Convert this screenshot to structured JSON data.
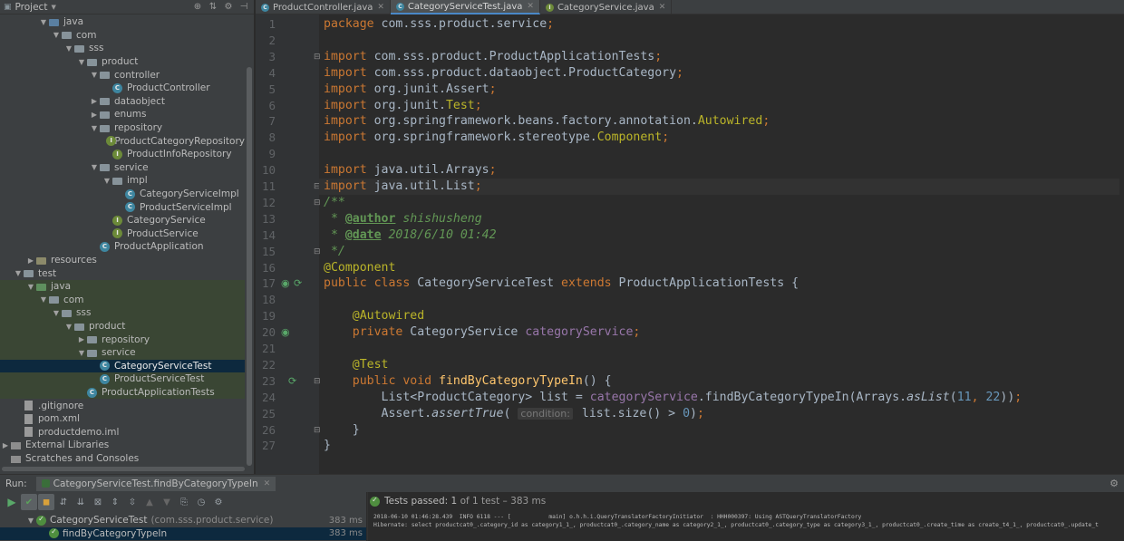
{
  "project": {
    "title": "Project",
    "tree": [
      {
        "label": "java",
        "indent": 3,
        "arrow": "down",
        "icon": "folder-src"
      },
      {
        "label": "com",
        "indent": 4,
        "arrow": "down",
        "icon": "folder"
      },
      {
        "label": "sss",
        "indent": 5,
        "arrow": "down",
        "icon": "folder"
      },
      {
        "label": "product",
        "indent": 6,
        "arrow": "down",
        "icon": "folder"
      },
      {
        "label": "controller",
        "indent": 7,
        "arrow": "down",
        "icon": "folder"
      },
      {
        "label": "ProductController",
        "indent": 8,
        "arrow": "",
        "icon": "cls"
      },
      {
        "label": "dataobject",
        "indent": 7,
        "arrow": "right",
        "icon": "folder"
      },
      {
        "label": "enums",
        "indent": 7,
        "arrow": "right",
        "icon": "folder"
      },
      {
        "label": "repository",
        "indent": 7,
        "arrow": "down",
        "icon": "folder"
      },
      {
        "label": "ProductCategoryRepository",
        "indent": 8,
        "arrow": "",
        "icon": "intf"
      },
      {
        "label": "ProductInfoRepository",
        "indent": 8,
        "arrow": "",
        "icon": "intf"
      },
      {
        "label": "service",
        "indent": 7,
        "arrow": "down",
        "icon": "folder"
      },
      {
        "label": "impl",
        "indent": 8,
        "arrow": "down",
        "icon": "folder"
      },
      {
        "label": "CategoryServiceImpl",
        "indent": 9,
        "arrow": "",
        "icon": "cls"
      },
      {
        "label": "ProductServiceImpl",
        "indent": 9,
        "arrow": "",
        "icon": "cls"
      },
      {
        "label": "CategoryService",
        "indent": 8,
        "arrow": "",
        "icon": "intf"
      },
      {
        "label": "ProductService",
        "indent": 8,
        "arrow": "",
        "icon": "intf"
      },
      {
        "label": "ProductApplication",
        "indent": 7,
        "arrow": "",
        "icon": "cls"
      },
      {
        "label": "resources",
        "indent": 2,
        "arrow": "right",
        "icon": "folder-res"
      },
      {
        "label": "test",
        "indent": 1,
        "arrow": "down",
        "icon": "folder"
      },
      {
        "label": "java",
        "indent": 2,
        "arrow": "down",
        "icon": "folder-test",
        "hl": true
      },
      {
        "label": "com",
        "indent": 3,
        "arrow": "down",
        "icon": "folder",
        "hl": true
      },
      {
        "label": "sss",
        "indent": 4,
        "arrow": "down",
        "icon": "folder",
        "hl": true
      },
      {
        "label": "product",
        "indent": 5,
        "arrow": "down",
        "icon": "folder",
        "hl": true
      },
      {
        "label": "repository",
        "indent": 6,
        "arrow": "right",
        "icon": "folder",
        "hl": true
      },
      {
        "label": "service",
        "indent": 6,
        "arrow": "down",
        "icon": "folder",
        "hl": true
      },
      {
        "label": "CategoryServiceTest",
        "indent": 7,
        "arrow": "",
        "icon": "cls",
        "selected": true
      },
      {
        "label": "ProductServiceTest",
        "indent": 7,
        "arrow": "",
        "icon": "cls",
        "hl": true
      },
      {
        "label": "ProductApplicationTests",
        "indent": 6,
        "arrow": "",
        "icon": "cls",
        "hl": true
      },
      {
        "label": ".gitignore",
        "indent": 1,
        "arrow": "",
        "icon": "file"
      },
      {
        "label": "pom.xml",
        "indent": 1,
        "arrow": "",
        "icon": "file"
      },
      {
        "label": "productdemo.iml",
        "indent": 1,
        "arrow": "",
        "icon": "file"
      },
      {
        "label": "External Libraries",
        "indent": 0,
        "arrow": "right",
        "icon": "lib"
      },
      {
        "label": "Scratches and Consoles",
        "indent": 0,
        "arrow": "",
        "icon": "lib"
      }
    ]
  },
  "tabs": [
    {
      "label": "ProductController.java",
      "icon": "cls",
      "active": false
    },
    {
      "label": "CategoryServiceTest.java",
      "icon": "cls",
      "active": true
    },
    {
      "label": "CategoryService.java",
      "icon": "intf",
      "active": false
    }
  ],
  "editor": {
    "line_numbers": [
      "1",
      "2",
      "3",
      "4",
      "5",
      "6",
      "7",
      "8",
      "9",
      "10",
      "11",
      "12",
      "13",
      "14",
      "15",
      "16",
      "17",
      "18",
      "19",
      "20",
      "21",
      "22",
      "23",
      "24",
      "25",
      "26",
      "27"
    ],
    "current_line": 11,
    "lines": [
      [
        {
          "t": "package ",
          "c": "kw"
        },
        {
          "t": "com.sss.product.service",
          "c": ""
        },
        {
          "t": ";",
          "c": "kw"
        }
      ],
      [],
      [
        {
          "t": "import ",
          "c": "kw"
        },
        {
          "t": "com.sss.product.ProductApplicationTests",
          "c": ""
        },
        {
          "t": ";",
          "c": "kw"
        }
      ],
      [
        {
          "t": "import ",
          "c": "kw"
        },
        {
          "t": "com.sss.product.dataobject.ProductCategory",
          "c": ""
        },
        {
          "t": ";",
          "c": "kw"
        }
      ],
      [
        {
          "t": "import ",
          "c": "kw"
        },
        {
          "t": "org.junit.Assert",
          "c": ""
        },
        {
          "t": ";",
          "c": "kw"
        }
      ],
      [
        {
          "t": "import ",
          "c": "kw"
        },
        {
          "t": "org.junit.",
          "c": ""
        },
        {
          "t": "Test",
          "c": "an"
        },
        {
          "t": ";",
          "c": "kw"
        }
      ],
      [
        {
          "t": "import ",
          "c": "kw"
        },
        {
          "t": "org.springframework.beans.factory.annotation.",
          "c": ""
        },
        {
          "t": "Autowired",
          "c": "an"
        },
        {
          "t": ";",
          "c": "kw"
        }
      ],
      [
        {
          "t": "import ",
          "c": "kw"
        },
        {
          "t": "org.springframework.stereotype.",
          "c": ""
        },
        {
          "t": "Component",
          "c": "an"
        },
        {
          "t": ";",
          "c": "kw"
        }
      ],
      [],
      [
        {
          "t": "import ",
          "c": "kw"
        },
        {
          "t": "java.util.Arrays",
          "c": ""
        },
        {
          "t": ";",
          "c": "kw"
        }
      ],
      [
        {
          "t": "import ",
          "c": "kw"
        },
        {
          "t": "java.util.List",
          "c": ""
        },
        {
          "t": ";",
          "c": "kw"
        }
      ],
      [
        {
          "t": "/**",
          "c": "doc"
        }
      ],
      [
        {
          "t": " * ",
          "c": "doc"
        },
        {
          "t": "@author",
          "c": "doctag"
        },
        {
          "t": " shishusheng",
          "c": "doc"
        }
      ],
      [
        {
          "t": " * ",
          "c": "doc"
        },
        {
          "t": "@date",
          "c": "doctag"
        },
        {
          "t": " 2018/6/10 01:42",
          "c": "doc"
        }
      ],
      [
        {
          "t": " */",
          "c": "doc"
        }
      ],
      [
        {
          "t": "@Component",
          "c": "an"
        }
      ],
      [
        {
          "t": "public class ",
          "c": "kw"
        },
        {
          "t": "CategoryServiceTest ",
          "c": ""
        },
        {
          "t": "extends ",
          "c": "kw"
        },
        {
          "t": "ProductApplicationTests {",
          "c": ""
        }
      ],
      [],
      [
        {
          "t": "    @Autowired",
          "c": "an"
        }
      ],
      [
        {
          "t": "    private ",
          "c": "kw"
        },
        {
          "t": "CategoryService ",
          "c": ""
        },
        {
          "t": "categoryService",
          "c": "fld"
        },
        {
          "t": ";",
          "c": "kw"
        }
      ],
      [],
      [
        {
          "t": "    @Test",
          "c": "an"
        }
      ],
      [
        {
          "t": "    public void ",
          "c": "kw"
        },
        {
          "t": "findByCategoryTypeIn",
          "c": "mth"
        },
        {
          "t": "() {",
          "c": ""
        }
      ],
      [
        {
          "t": "        List<ProductCategory> list = ",
          "c": ""
        },
        {
          "t": "categoryService",
          "c": "fld"
        },
        {
          "t": ".findByCategoryTypeIn(Arrays.",
          "c": ""
        },
        {
          "t": "asList",
          "c": "it"
        },
        {
          "t": "(",
          "c": ""
        },
        {
          "t": "11",
          "c": "num"
        },
        {
          "t": ", ",
          "c": "kw"
        },
        {
          "t": "22",
          "c": "num"
        },
        {
          "t": "))",
          "c": ""
        },
        {
          "t": ";",
          "c": "kw"
        }
      ],
      [
        {
          "t": "        Assert.",
          "c": ""
        },
        {
          "t": "assertTrue",
          "c": "it"
        },
        {
          "t": "( ",
          "c": ""
        },
        {
          "t": "condition:",
          "c": "hint"
        },
        {
          "t": " list.size() > ",
          "c": ""
        },
        {
          "t": "0",
          "c": "num"
        },
        {
          "t": ")",
          "c": ""
        },
        {
          "t": ";",
          "c": "kw"
        }
      ],
      [
        {
          "t": "    }",
          "c": ""
        }
      ],
      [
        {
          "t": "}",
          "c": ""
        }
      ]
    ]
  },
  "run": {
    "label": "Run:",
    "tab_label": "CategoryServiceTest.findByCategoryTypeIn",
    "status_prefix": "Tests passed:",
    "status_count": "1",
    "status_suffix": "of 1 test – 383 ms",
    "tree": [
      {
        "label": "CategoryServiceTest",
        "pkg": "(com.sss.product.service)",
        "time": "383 ms",
        "indent": 2,
        "arrow": "down"
      },
      {
        "label": "findByCategoryTypeIn",
        "pkg": "",
        "time": "383 ms",
        "indent": 3,
        "arrow": "",
        "selected": true
      }
    ],
    "log": [
      "2018-06-10 01:46:28.439  INFO 6118 --- [           main] o.h.h.i.QueryTranslatorFactoryInitiator  : HHH000397: Using ASTQueryTranslatorFactory",
      "Hibernate: select productcat0_.category_id as category1_1_, productcat0_.category_name as category2_1_, productcat0_.category_type as category3_1_, productcat0_.create_time as create_t4_1_, productcat0_.update_t"
    ]
  },
  "colors": {
    "accent": "#4a88c7",
    "keyword": "#cc7832",
    "annotation": "#bbb529",
    "field": "#9876aa",
    "method": "#ffc66d",
    "number": "#6897bb",
    "doc": "#629755"
  }
}
